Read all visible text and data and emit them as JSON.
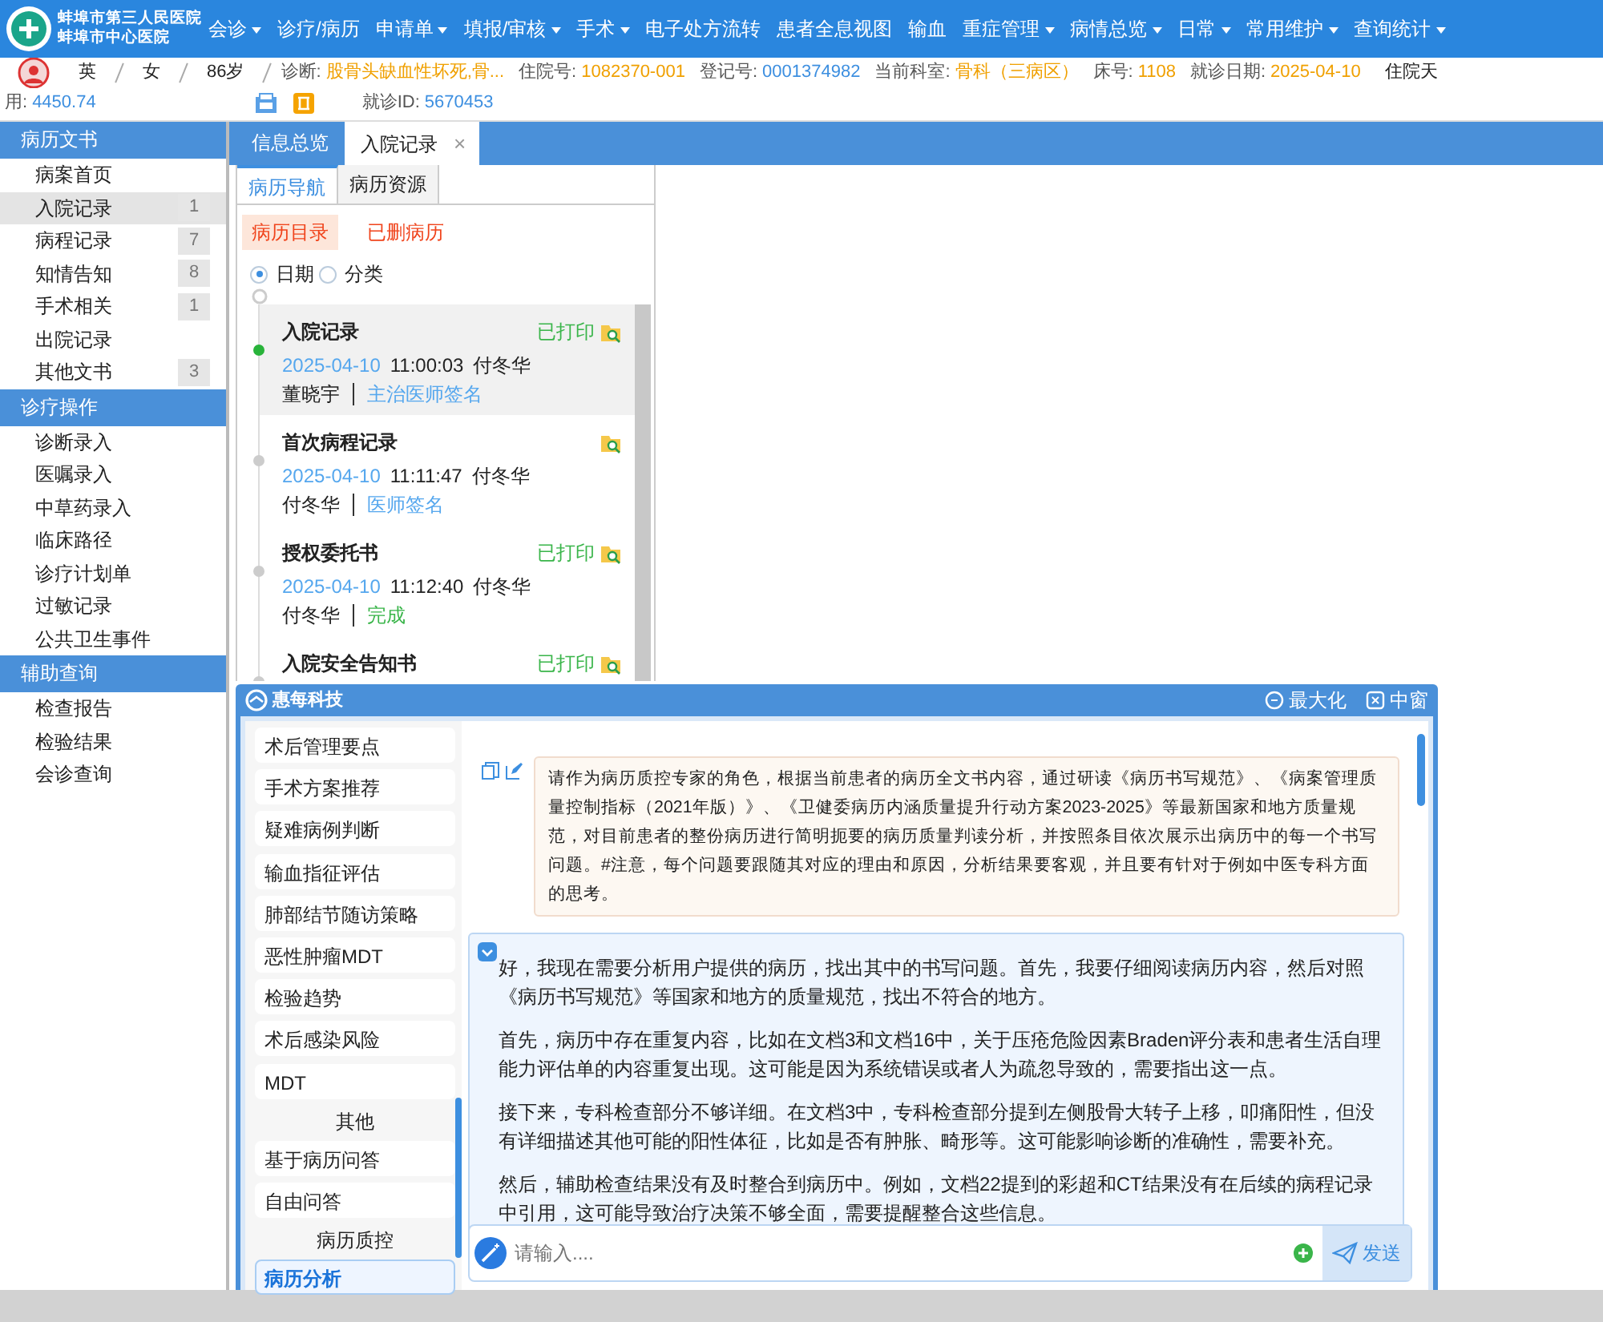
{
  "header": {
    "hospital_name_1": "蚌埠市第三人民医院",
    "hospital_name_2": "蚌埠市中心医院"
  },
  "menu": [
    {
      "label": "会诊",
      "dropdown": true
    },
    {
      "label": "诊疗/病历",
      "dropdown": false
    },
    {
      "label": "申请单",
      "dropdown": true
    },
    {
      "label": "填报/审核",
      "dropdown": true
    },
    {
      "label": "手术",
      "dropdown": true
    },
    {
      "label": "电子处方流转",
      "dropdown": false
    },
    {
      "label": "患者全息视图",
      "dropdown": false
    },
    {
      "label": "输血",
      "dropdown": false
    },
    {
      "label": "重症管理",
      "dropdown": true
    },
    {
      "label": "病情总览",
      "dropdown": true
    },
    {
      "label": "日常",
      "dropdown": true
    },
    {
      "label": "常用维护",
      "dropdown": true
    },
    {
      "label": "查询统计",
      "dropdown": true
    }
  ],
  "patient_info": {
    "line_1": [
      {
        "kind": "avatar"
      },
      {
        "kind": "text",
        "value": "英"
      },
      {
        "kind": "sep"
      },
      {
        "kind": "text",
        "value": "女"
      },
      {
        "kind": "sep"
      },
      {
        "kind": "text",
        "value": "86岁"
      },
      {
        "kind": "sep"
      },
      {
        "kind": "field",
        "label": "诊断:",
        "value": "股骨头缺血性坏死,骨...",
        "color": "#f0a000"
      },
      {
        "kind": "field",
        "label": "住院号:",
        "value": "1082370-001",
        "color": "#f0a000"
      },
      {
        "kind": "field",
        "label": "登记号:",
        "value": "0001374982",
        "color": "#3d8fe0"
      },
      {
        "kind": "field",
        "label": "当前科室:",
        "value": "骨科（三病区）",
        "color": "#f0a000"
      },
      {
        "kind": "field",
        "label": "床号:",
        "value": "1108",
        "color": "#f0a000"
      },
      {
        "kind": "field",
        "label": "就诊日期:",
        "value": "2025-04-10",
        "color": "#f0a000"
      },
      {
        "kind": "text",
        "value": "住院天"
      }
    ],
    "line_2": [
      {
        "kind": "field",
        "label": "用:",
        "value": "4450.74",
        "color": "#3d8fe0"
      },
      {
        "kind": "blank"
      },
      {
        "kind": "card"
      },
      {
        "kind": "badge"
      },
      {
        "kind": "field",
        "label": "就诊ID:",
        "value": "5670453",
        "color": "#3d8fe0"
      }
    ]
  },
  "sidebar": [
    {
      "title": "病历文书",
      "items": [
        {
          "label": "病案首页",
          "selected": false
        },
        {
          "label": "入院记录",
          "count": "1",
          "selected": true
        },
        {
          "label": "病程记录",
          "count": "7",
          "selected": false
        },
        {
          "label": "知情告知",
          "count": "8",
          "selected": false
        },
        {
          "label": "手术相关",
          "count": "1",
          "selected": false
        },
        {
          "label": "出院记录",
          "selected": false
        },
        {
          "label": "其他文书",
          "count": "3",
          "selected": false
        }
      ]
    },
    {
      "title": "诊疗操作",
      "items": [
        {
          "label": "诊断录入",
          "selected": false
        },
        {
          "label": "医嘱录入",
          "selected": false
        },
        {
          "label": "中草药录入",
          "selected": false
        },
        {
          "label": "临床路径",
          "selected": false
        },
        {
          "label": "诊疗计划单",
          "selected": false
        },
        {
          "label": "过敏记录",
          "selected": false
        },
        {
          "label": "公共卫生事件",
          "selected": false
        }
      ]
    },
    {
      "title": "辅助查询",
      "items": [
        {
          "label": "检查报告",
          "selected": false
        },
        {
          "label": "检验结果",
          "selected": false
        },
        {
          "label": "会诊查询",
          "selected": false
        }
      ]
    }
  ],
  "tabs": [
    {
      "label": "信息总览",
      "selected": false
    },
    {
      "label": "入院记录",
      "selected": true,
      "close": "×"
    }
  ],
  "subtabs": [
    {
      "label": "病历导航",
      "selected": true
    },
    {
      "label": "病历资源",
      "selected": false
    }
  ],
  "filters": [
    {
      "label": "病历目录",
      "selected": true
    },
    {
      "label": "已删病历",
      "selected": false
    }
  ],
  "radios": [
    {
      "label": "日期",
      "selected": true
    },
    {
      "label": "分类",
      "selected": false
    }
  ],
  "records": [
    {
      "title": "入院记录",
      "printed": "已打印",
      "date": "2025-04-10",
      "time": "11:00:03",
      "author": "付冬华",
      "signer": "董晓宇",
      "action": "主治医师签名",
      "completed": false,
      "selected": true
    },
    {
      "title": "首次病程记录",
      "date": "2025-04-10",
      "time": "11:11:47",
      "author": "付冬华",
      "signer": "付冬华",
      "action": "医师签名",
      "completed": false,
      "selected": false
    },
    {
      "title": "授权委托书",
      "printed": "已打印",
      "date": "2025-04-10",
      "time": "11:12:40",
      "author": "付冬华",
      "signer": "付冬华",
      "action": "完成",
      "completed": true,
      "selected": false
    },
    {
      "title": "入院安全告知书",
      "printed": "已打印",
      "selected": false
    }
  ],
  "assistant": {
    "logo": "惠每科技",
    "buttons": [
      "最大化",
      "中窗"
    ],
    "menu": [
      {
        "kind": "item",
        "label": "术后管理要点",
        "selected": false
      },
      {
        "kind": "item",
        "label": "手术方案推荐",
        "selected": false
      },
      {
        "kind": "item",
        "label": "疑难病例判断",
        "selected": false
      },
      {
        "kind": "item",
        "label": "输血指征评估",
        "selected": false
      },
      {
        "kind": "item",
        "label": "肺部结节随访策略",
        "selected": false
      },
      {
        "kind": "item",
        "label": "恶性肿瘤MDT",
        "selected": false
      },
      {
        "kind": "item",
        "label": "检验趋势",
        "selected": false
      },
      {
        "kind": "item",
        "label": "术后感染风险",
        "selected": false
      },
      {
        "kind": "item",
        "label": "MDT",
        "selected": false
      },
      {
        "kind": "heading",
        "label": "其他"
      },
      {
        "kind": "item",
        "label": "基于病历问答",
        "selected": false
      },
      {
        "kind": "item",
        "label": "自由问答",
        "selected": false
      },
      {
        "kind": "heading",
        "label": "病历质控"
      },
      {
        "kind": "item",
        "label": "病历分析",
        "selected": true
      }
    ],
    "prompt": "请作为病历质控专家的角色，根据当前患者的病历全文书内容，通过研读《病历书写规范》、《病案管理质量控制指标（2021年版）》、《卫健委病历内涵质量提升行动方案2023-2025》等最新国家和地方质量规范，对目前患者的整份病历进行简明扼要的病历质量判读分析，并按照条目依次展示出病历中的每一个书写问题。#注意，每个问题要跟随其对应的理由和原因，分析结果要客观，并且要有针对于例如中医专科方面的思考。",
    "answer": [
      "好，我现在需要分析用户提供的病历，找出其中的书写问题。首先，我要仔细阅读病历内容，然后对照《病历书写规范》等国家和地方的质量规范，找出不符合的地方。",
      "首先，病历中存在重复内容，比如在文档3和文档16中，关于压疮危险因素Braden评分表和患者生活自理能力评估单的内容重复出现。这可能是因为系统错误或者人为疏忽导致的，需要指出这一点。",
      "接下来，专科检查部分不够详细。在文档3中，专科检查部分提到左侧股骨大转子上移，叩痛阳性，但没有详细描述其他可能的阳性体征，比如是否有肿胀、畸形等。这可能影响诊断的准确性，需要补充。",
      "然后，辅助检查结果没有及时整合到病历中。例如，文档22提到的彩超和CT结果没有在后续的病程记录中引用，这可能导致治疗决策不够全面，需要提醒整合这些信息。"
    ],
    "input": {
      "placeholder": "请输入...."
    },
    "send": "发送"
  }
}
